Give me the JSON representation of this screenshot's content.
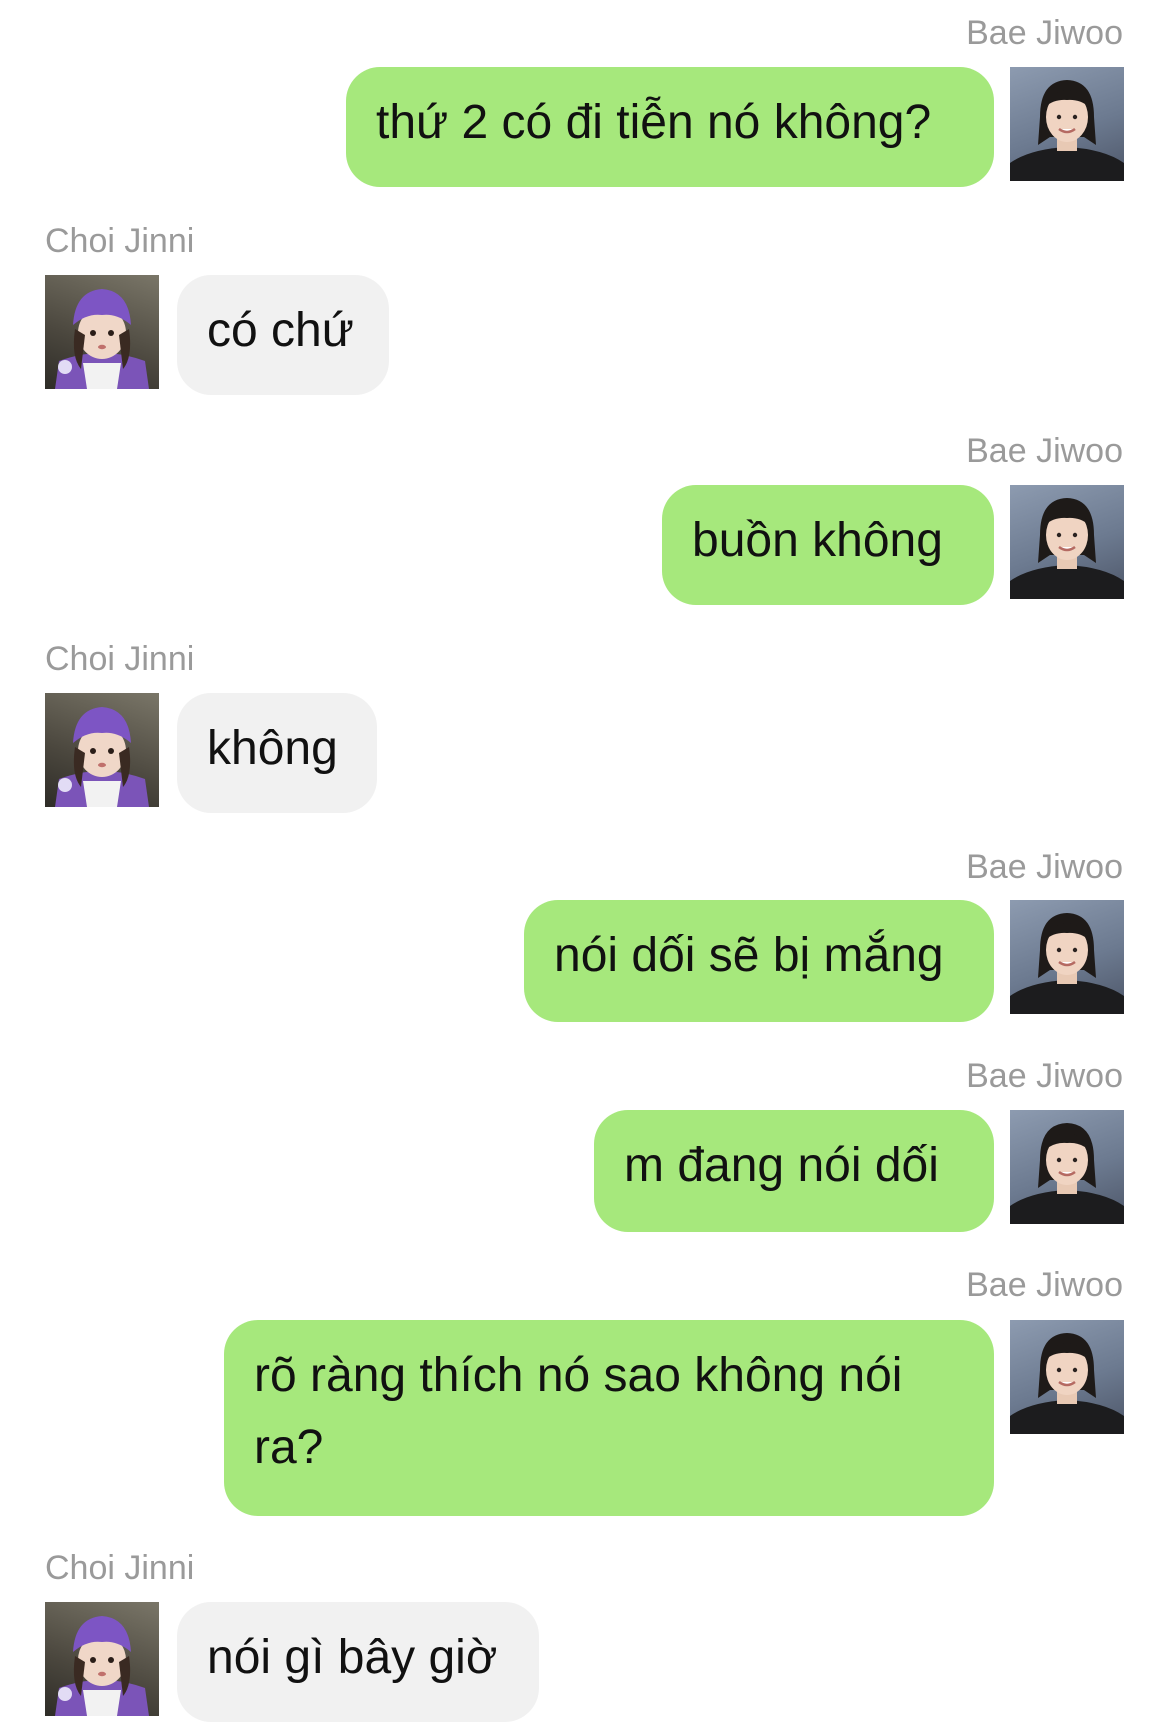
{
  "messages": [
    {
      "sender": "Bae Jiwoo",
      "side": "sent",
      "text": "thứ 2 có đi tiễn nó không?"
    },
    {
      "sender": "Choi Jinni",
      "side": "recv",
      "text": "có chứ"
    },
    {
      "sender": "Bae Jiwoo",
      "side": "sent",
      "text": "buồn không"
    },
    {
      "sender": "Choi Jinni",
      "side": "recv",
      "text": "không"
    },
    {
      "sender": "Bae Jiwoo",
      "side": "sent",
      "text": "nói dối sẽ bị mắng"
    },
    {
      "sender": "Bae Jiwoo",
      "side": "sent",
      "text": "m đang nói dối"
    },
    {
      "sender": "Bae Jiwoo",
      "side": "sent",
      "text": "rõ ràng thích nó sao không nói ra?"
    },
    {
      "sender": "Choi Jinni",
      "side": "recv",
      "text": "nói gì bây giờ"
    }
  ],
  "colors": {
    "sent_bubble": "#a6e87c",
    "recv_bubble": "#f1f1f1",
    "sender_name": "#9a9a9a",
    "message_text": "#111111"
  },
  "icons": {
    "jiwoo_avatar": "profile-photo-bae-jiwoo",
    "jinni_avatar": "profile-photo-choi-jinni"
  }
}
